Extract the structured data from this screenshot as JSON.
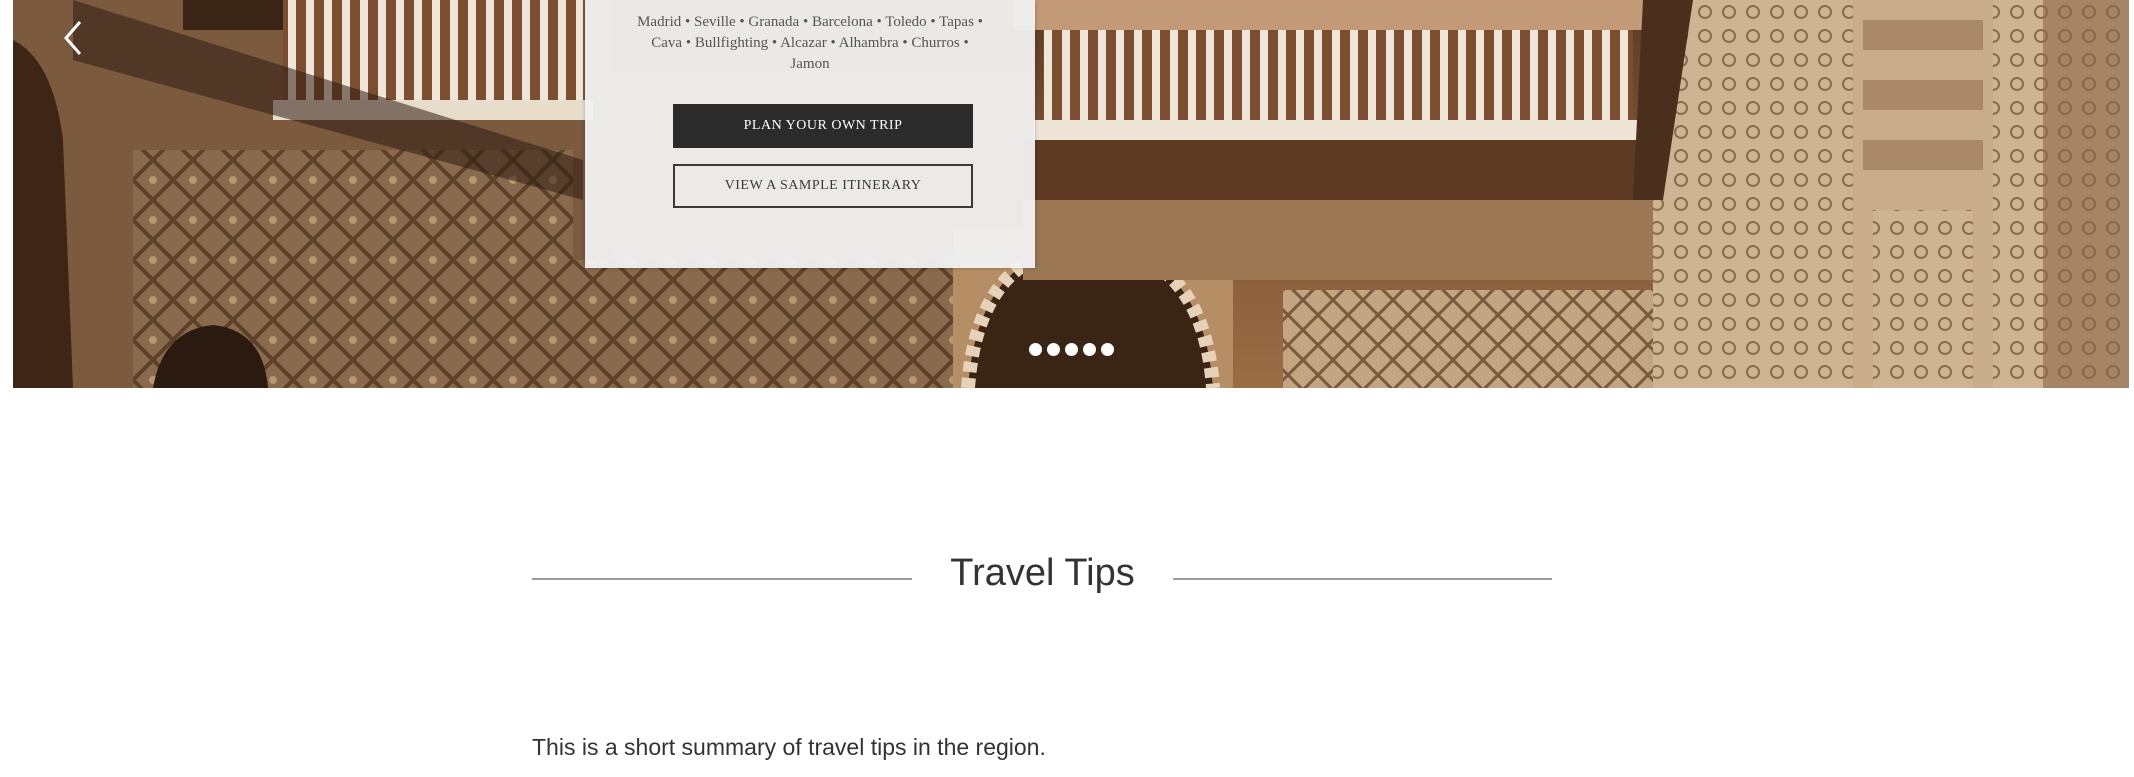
{
  "hero": {
    "places_line": "Madrid • Seville • Granada • Barcelona • Toledo • Tapas • Cava • Bullfighting • Alcazar • Alhambra • Churros • Jamon",
    "plan_button": "PLAN YOUR OWN TRIP",
    "sample_button": "VIEW A SAMPLE ITINERARY",
    "slide_count": 5,
    "prev_icon": "chevron-left-icon"
  },
  "tips": {
    "title": "Travel Tips",
    "summary": "This is a short summary of travel tips in the region."
  },
  "colors": {
    "button_dark": "#2b2b2b",
    "overlay_bg": "#f0f0f0",
    "rule": "#9a9a9a",
    "text": "#333333"
  }
}
